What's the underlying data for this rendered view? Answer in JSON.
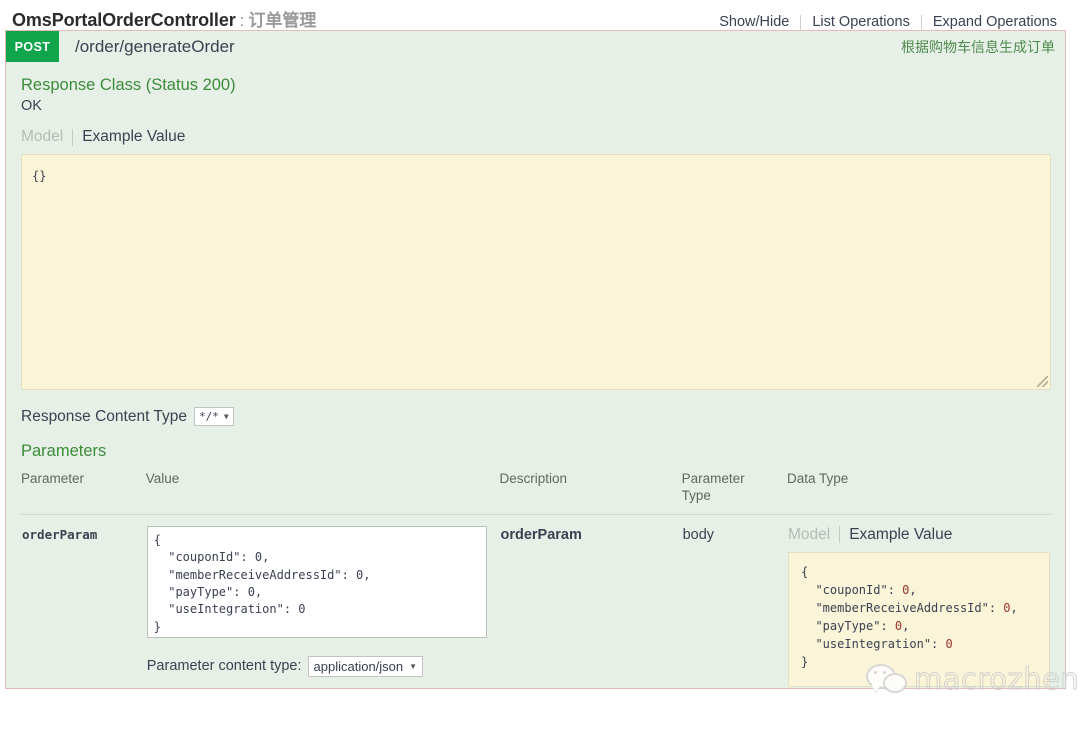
{
  "resource": {
    "title": "OmsPortalOrderController",
    "separator": ":",
    "subtitle": "订单管理",
    "links": [
      {
        "label": "Show/Hide"
      },
      {
        "label": "List Operations"
      },
      {
        "label": "Expand Operations"
      }
    ]
  },
  "operation": {
    "method": "POST",
    "path": "/order/generateOrder",
    "summary": "根据购物车信息生成订单",
    "method_color": "#10a54a"
  },
  "response_class": {
    "heading": "Response Class (Status 200)",
    "status_text": "OK",
    "tabs": {
      "model": "Model",
      "example": "Example Value"
    },
    "example_body": "{}"
  },
  "response_content_type": {
    "label": "Response Content Type",
    "selected": "*/*",
    "caret": "▼"
  },
  "parameters_section": {
    "title": "Parameters",
    "columns": {
      "parameter": "Parameter",
      "value": "Value",
      "description": "Description",
      "parameter_type": "Parameter\nType",
      "parameter_type_line1": "Parameter",
      "parameter_type_line2": "Type",
      "data_type": "Data Type"
    },
    "rows": [
      {
        "parameter": "orderParam",
        "value_textarea": "{\n  \"couponId\": 0,\n  \"memberReceiveAddressId\": 0,\n  \"payType\": 0,\n  \"useIntegration\": 0\n}",
        "description": "orderParam",
        "parameter_type": "body",
        "data_type": {
          "tabs": {
            "model": "Model",
            "example": "Example Value"
          },
          "example_lines": [
            {
              "indent": 0,
              "text": "{"
            },
            {
              "indent": 1,
              "key": "\"couponId\"",
              "value": "0",
              "comma": ","
            },
            {
              "indent": 1,
              "key": "\"memberReceiveAddressId\"",
              "value": "0",
              "comma": ","
            },
            {
              "indent": 1,
              "key": "\"payType\"",
              "value": "0",
              "comma": ","
            },
            {
              "indent": 1,
              "key": "\"useIntegration\"",
              "value": "0",
              "comma": ""
            },
            {
              "indent": 0,
              "text": "}"
            }
          ]
        }
      }
    ],
    "content_type": {
      "label": "Parameter content type:",
      "selected": "application/json",
      "caret": "▼"
    }
  },
  "watermark": {
    "text": "macrozheng"
  }
}
